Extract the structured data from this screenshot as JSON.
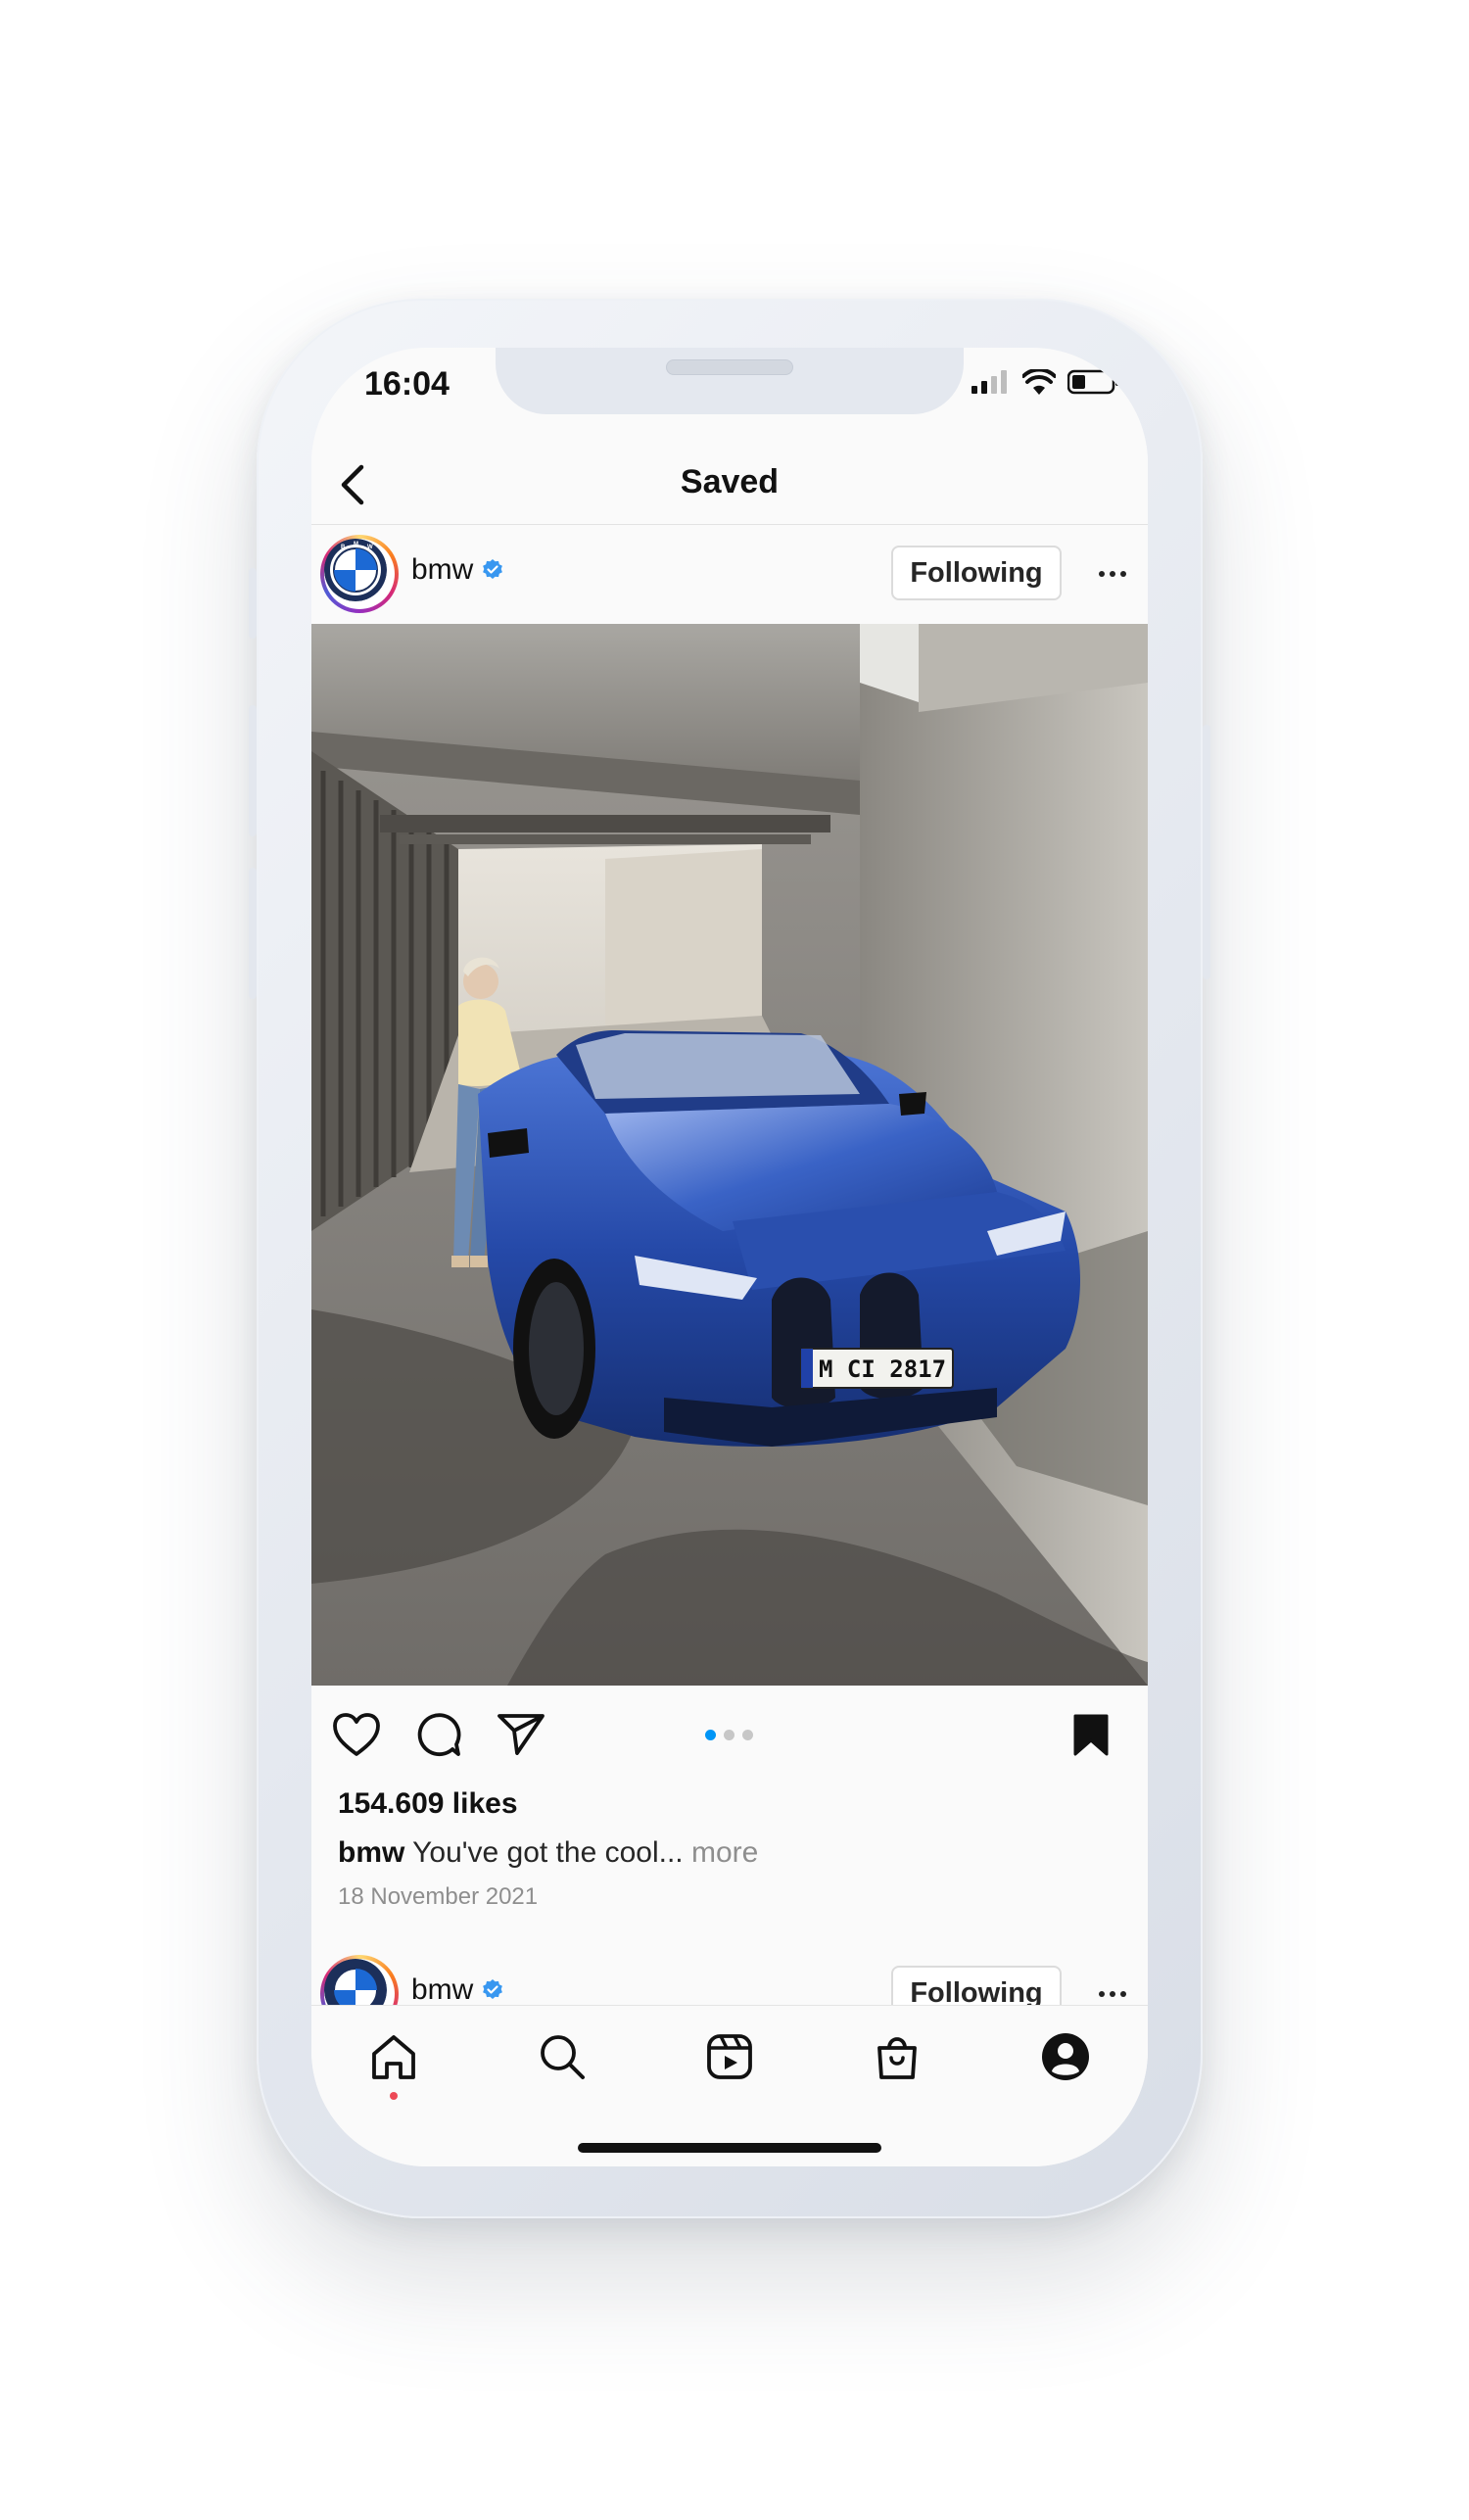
{
  "status_bar": {
    "time": "16:04"
  },
  "nav": {
    "title": "Saved",
    "back_icon": "chevron-left-icon"
  },
  "post": {
    "username": "bmw",
    "verified": true,
    "follow_label": "Following",
    "image_subject": "blue-bmw-m4-in-concrete-underpass",
    "plate_text": "M CI 2817",
    "carousel": {
      "total": 3,
      "active": 1
    },
    "likes": "154.609 likes",
    "caption_user": "bmw",
    "caption_text": "You've got the cool...",
    "caption_more": "more",
    "date": "18 November 2021"
  },
  "next_post": {
    "username": "bmw",
    "follow_label": "Following"
  },
  "tab_bar": {
    "items": [
      "home-icon",
      "search-icon",
      "reels-icon",
      "shop-icon",
      "profile-icon"
    ],
    "active": "home-icon"
  },
  "colors": {
    "accent_blue": "#0095f6",
    "verified_blue": "#3897f0",
    "notification_red": "#ed4956",
    "car_blue": "#1d3f9a"
  }
}
